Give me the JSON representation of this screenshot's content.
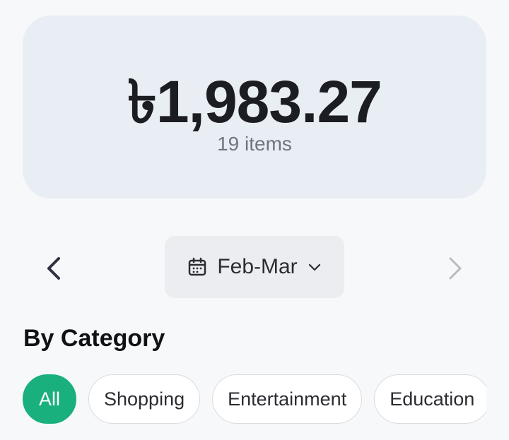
{
  "summary": {
    "total": "৳1,983.27",
    "count": "19 items"
  },
  "period": {
    "label": "Feb-Mar",
    "icon": "calendar-icon",
    "dropdown_icon": "chevron-down-icon",
    "prev_icon": "chevron-left-icon",
    "next_icon": "chevron-right-icon",
    "next_enabled": false
  },
  "category_section": {
    "title": "By Category",
    "chips": [
      {
        "label": "All",
        "selected": true
      },
      {
        "label": "Shopping",
        "selected": false
      },
      {
        "label": "Entertainment",
        "selected": false
      },
      {
        "label": "Education",
        "selected": false
      }
    ]
  },
  "colors": {
    "accent": "#19b07e",
    "card_bg": "#e9eef4",
    "page_bg": "#f7f8fa"
  }
}
